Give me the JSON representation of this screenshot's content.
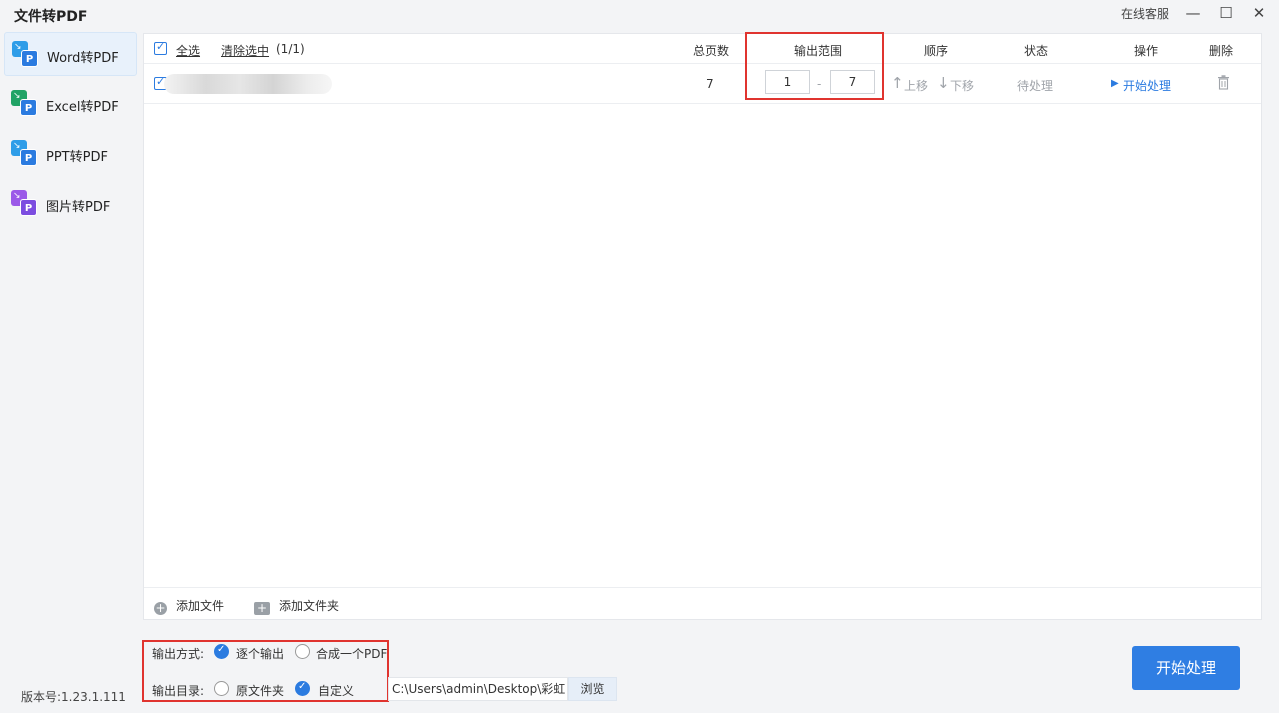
{
  "app": {
    "title": "文件转PDF",
    "support": "在线客服"
  },
  "window": {
    "minimize": "—",
    "maximize": "☐",
    "close": "✕"
  },
  "sidebar": {
    "items": [
      {
        "label": "Word转PDF",
        "color": "#2b7be0",
        "back": "#2e9de8",
        "icon": "word-pdf-icon"
      },
      {
        "label": "Excel转PDF",
        "color": "#2b7be0",
        "back": "#21a366",
        "icon": "excel-pdf-icon"
      },
      {
        "label": "PPT转PDF",
        "color": "#2b7be0",
        "back": "#2e9de8",
        "icon": "ppt-pdf-icon"
      },
      {
        "label": "图片转PDF",
        "color": "#7c4de0",
        "back": "#9b59e8",
        "icon": "image-pdf-icon"
      }
    ]
  },
  "table": {
    "select_all": "全选",
    "clear_selection": "清除选中",
    "selection_count": "(1/1)",
    "headers": {
      "pages": "总页数",
      "range": "输出范围",
      "order": "顺序",
      "status": "状态",
      "action": "操作",
      "delete": "删除"
    },
    "rows": [
      {
        "pages": "7",
        "range_from": "1",
        "range_sep": "-",
        "range_to": "7",
        "move_up": "上移",
        "move_down": "下移",
        "status": "待处理",
        "action": "开始处理"
      }
    ]
  },
  "add_bar": {
    "add_file": "添加文件",
    "add_folder": "添加文件夹"
  },
  "output": {
    "mode_label": "输出方式:",
    "mode_options": [
      "逐个输出",
      "合成一个PDF"
    ],
    "mode_selected": "逐个输出",
    "dir_label": "输出目录:",
    "dir_options": [
      "原文件夹",
      "自定义"
    ],
    "dir_selected": "自定义",
    "path": "C:\\Users\\admin\\Desktop\\彩虹",
    "browse": "浏览"
  },
  "version": "版本号:1.23.1.111",
  "start_button": "开始处理",
  "colors": {
    "accent": "#2b7be0",
    "highlight": "#e0342f"
  }
}
